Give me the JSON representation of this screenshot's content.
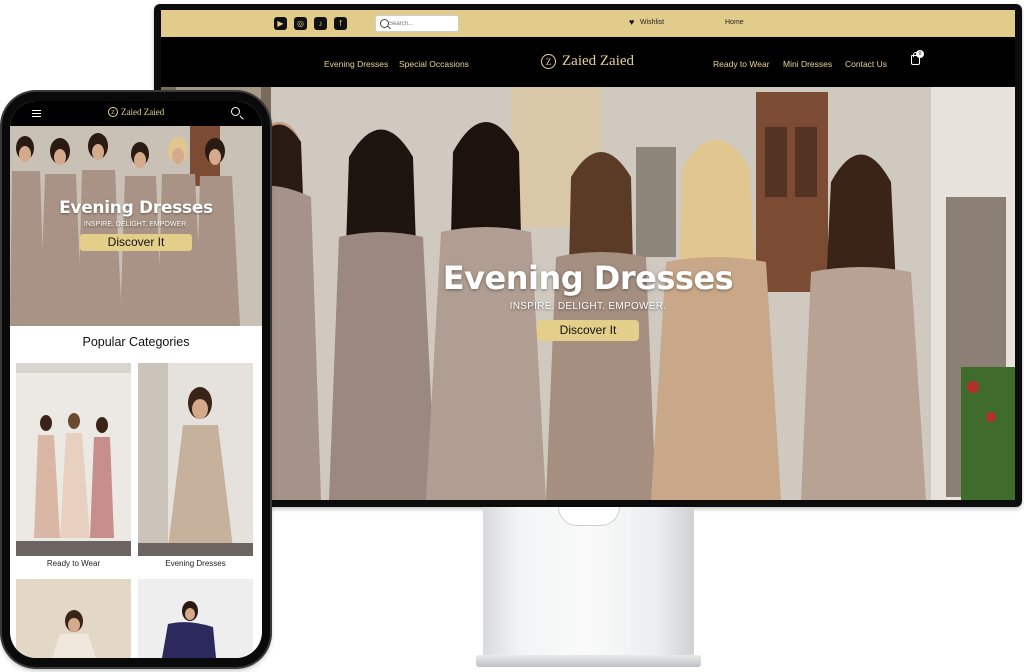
{
  "desktop": {
    "topbar": {
      "social_icons": [
        "youtube-icon",
        "instagram-icon",
        "tiktok-icon",
        "facebook-icon"
      ],
      "search_placeholder": "Search...",
      "wishlist": "Wishlist",
      "home": "Home"
    },
    "nav": {
      "left_links": [
        "Evening Dresses",
        "Special Occasions"
      ],
      "right_links": [
        "Ready to Wear",
        "Mini Dresses",
        "Contact Us"
      ],
      "brand": "Zaied Zaied",
      "cart_count": "0"
    },
    "hero": {
      "title": "Evening Dresses",
      "subtitle": "INSPIRE. DELIGHT. EMPOWER.",
      "cta": "Discover It"
    }
  },
  "mobile": {
    "brand": "Zaied Zaied",
    "hero": {
      "title": "Evening Dresses",
      "subtitle": "INSPIRE. DELIGHT. EMPOWER.",
      "cta": "Discover It"
    },
    "section_title": "Popular Categories",
    "categories": [
      {
        "label": "Ready to Wear"
      },
      {
        "label": "Evening Dresses"
      }
    ]
  },
  "colors": {
    "gold": "#e2cc8c",
    "black": "#000000",
    "white": "#ffffff"
  }
}
